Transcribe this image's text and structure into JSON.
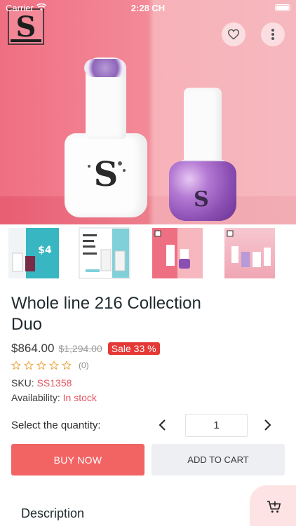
{
  "status_bar": {
    "carrier": "Carrier",
    "time": "2:28 CH"
  },
  "hero": {
    "brand_logo_icon": "brand-logo-s-icon",
    "favorite_icon": "heart-outline-icon",
    "more_icon": "more-vertical-icon"
  },
  "thumbnails": [
    {
      "name": "thumbnail-1",
      "price_text": "$4"
    },
    {
      "name": "thumbnail-2"
    },
    {
      "name": "thumbnail-3"
    },
    {
      "name": "thumbnail-4"
    }
  ],
  "product": {
    "title": "Whole line 216 Collection Duo",
    "price": "$864.00",
    "old_price": "$1,294.00",
    "sale_badge": "Sale 33 %",
    "rating": 0,
    "review_count": "(0)",
    "sku_label": "SKU:",
    "sku_value": "SS1358",
    "availability_label": "Availability:",
    "availability_value": "In stock"
  },
  "quantity": {
    "label": "Select the quantity:",
    "value": "1"
  },
  "actions": {
    "buy_now": "BUY NOW",
    "add_to_cart": "ADD TO CART"
  },
  "description": {
    "title": "Description"
  },
  "colors": {
    "accent": "#f26464",
    "sale": "#e53935",
    "highlight_text": "#e25563",
    "fab_bg": "#fde3e3"
  }
}
